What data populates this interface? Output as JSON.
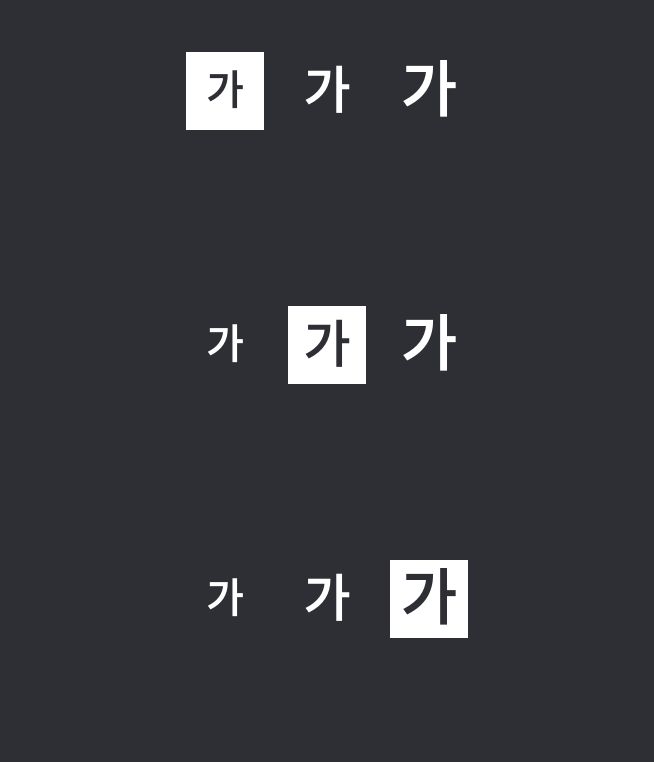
{
  "font_size_options": {
    "glyph": "가",
    "rows": [
      {
        "selected": "small",
        "options": [
          {
            "size": "small",
            "label": "가"
          },
          {
            "size": "medium",
            "label": "가"
          },
          {
            "size": "large",
            "label": "가"
          }
        ]
      },
      {
        "selected": "medium",
        "options": [
          {
            "size": "small",
            "label": "가"
          },
          {
            "size": "medium",
            "label": "가"
          },
          {
            "size": "large",
            "label": "가"
          }
        ]
      },
      {
        "selected": "large",
        "options": [
          {
            "size": "small",
            "label": "가"
          },
          {
            "size": "medium",
            "label": "가"
          },
          {
            "size": "large",
            "label": "가"
          }
        ]
      }
    ]
  },
  "colors": {
    "background": "#2e2f35",
    "text": "#ffffff",
    "selected_background": "#ffffff",
    "selected_text": "#2e2f35"
  }
}
